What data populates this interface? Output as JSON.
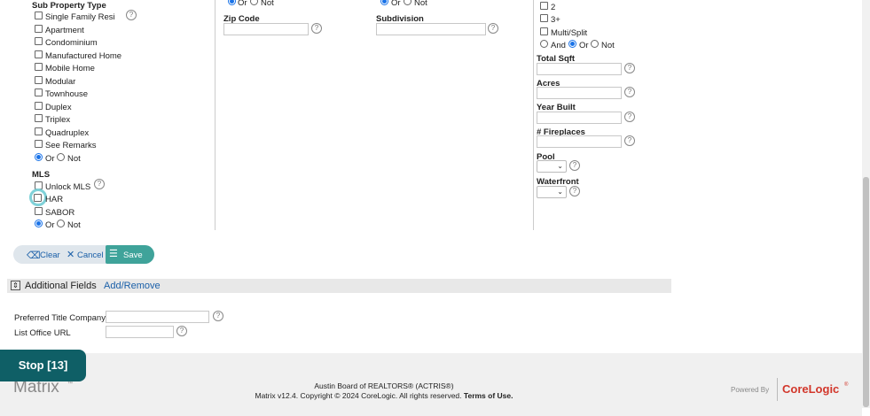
{
  "sub_property": {
    "title": "Sub Property Type",
    "items": [
      "Single Family Resi",
      "Apartment",
      "Condominium",
      "Manufactured Home",
      "Mobile Home",
      "Modular",
      "Townhouse",
      "Duplex",
      "Triplex",
      "Quadruplex",
      "See Remarks"
    ],
    "or_label": "Or",
    "not_label": "Not"
  },
  "mls": {
    "title": "MLS",
    "unlock_label": "Unlock MLS",
    "items": [
      "HAR",
      "SABOR"
    ],
    "or_label": "Or",
    "not_label": "Not"
  },
  "middle": {
    "top_or": "Or",
    "top_not": "Not",
    "zip_label": "Zip Code",
    "subdivision_label": "Subdivision",
    "top_or2": "Or",
    "top_not2": "Not"
  },
  "right": {
    "opt_2": "2",
    "opt_3plus": "3+",
    "multi_split": "Multi/Split",
    "and_label": "And",
    "or_label": "Or",
    "not_label": "Not",
    "total_sqft": "Total Sqft",
    "acres": "Acres",
    "year_built": "Year Built",
    "fireplaces": "# Fireplaces",
    "pool": "Pool",
    "waterfront": "Waterfront"
  },
  "actions": {
    "clear": "Clear",
    "cancel": "Cancel",
    "save": "Save"
  },
  "additional": {
    "title": "Additional Fields",
    "add_remove": "Add/Remove",
    "preferred_title": "Preferred Title Company",
    "list_office_url": "List Office URL"
  },
  "stop_badge": "Stop [13]",
  "footer": {
    "logo": "Matrix",
    "logo_tm": "™",
    "line1": "Austin Board of REALTORS® (ACTRIS®)",
    "line2": "Matrix v12.4. Copyright © 2024 CoreLogic. All rights reserved.",
    "terms": "Terms of Use.",
    "powered_by": "Powered By",
    "corelogic": "CoreLogic",
    "corelogic_reg": "®"
  },
  "help_glyph": "?",
  "chevron_glyph": "⌄",
  "colors": {
    "accent": "#1a73e8",
    "teal": "#3fa39a",
    "stop_bg": "#0f5f66",
    "link": "#1a5fa8",
    "corelogic": "#d2372b"
  }
}
